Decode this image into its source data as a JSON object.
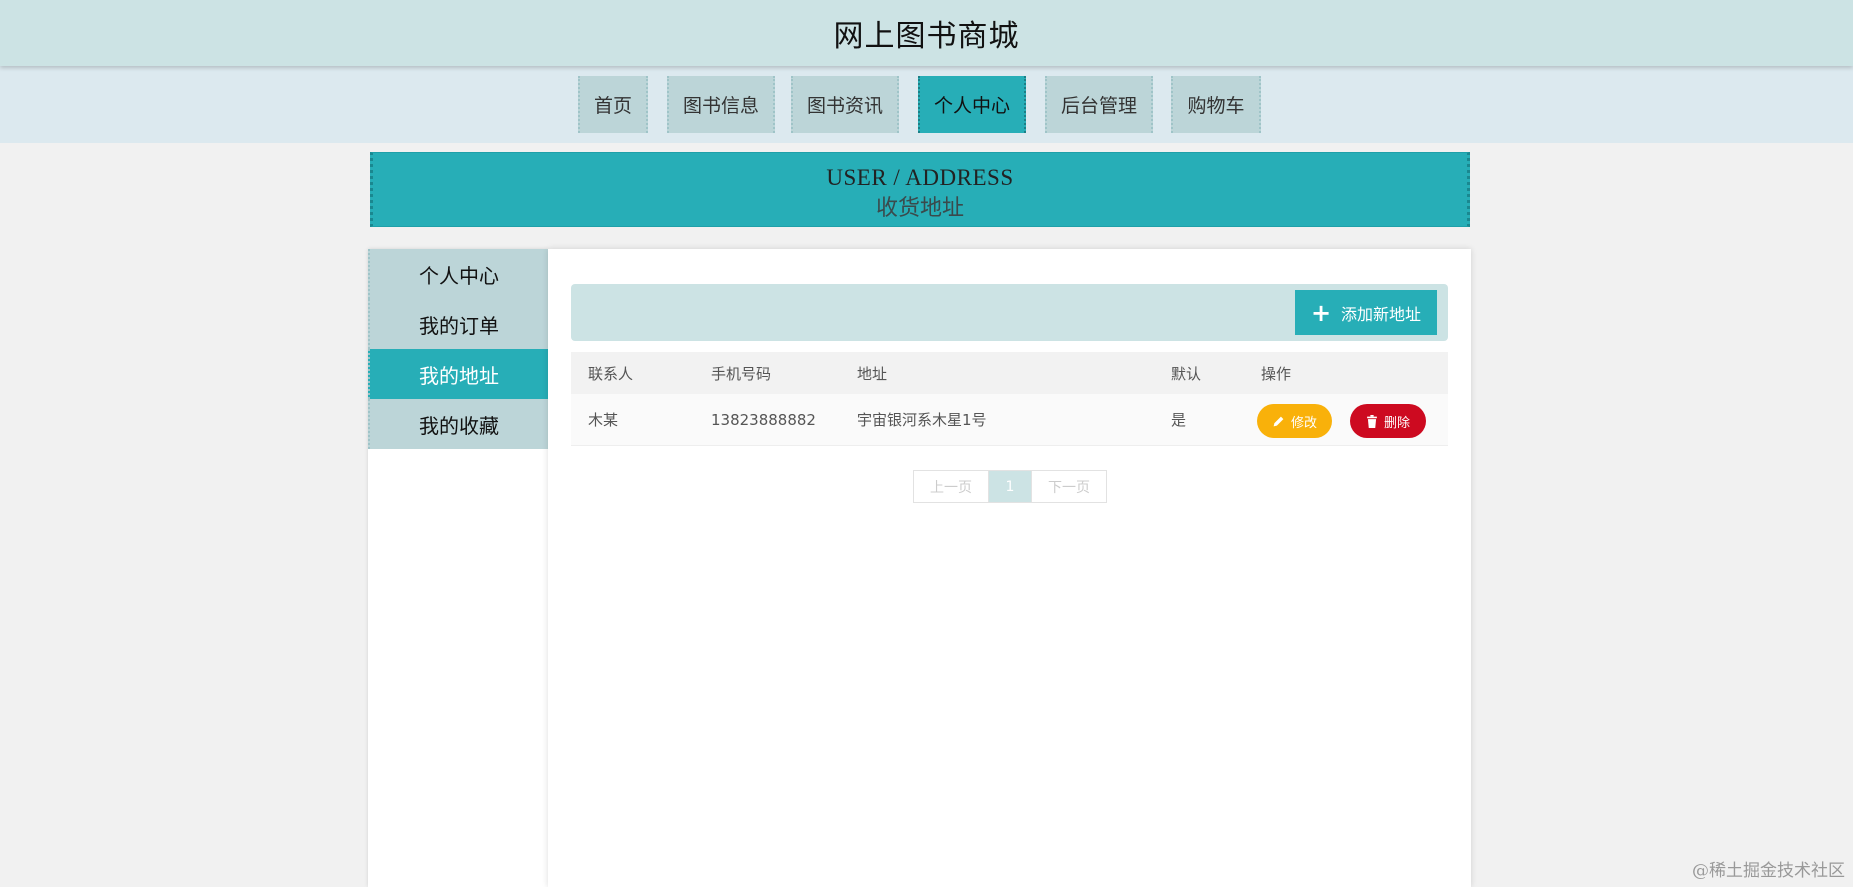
{
  "header": {
    "title": "网上图书商城"
  },
  "nav": {
    "items": [
      {
        "label": "首页"
      },
      {
        "label": "图书信息"
      },
      {
        "label": "图书资讯"
      },
      {
        "label": "个人中心",
        "active": true
      },
      {
        "label": "后台管理"
      },
      {
        "label": "购物车"
      }
    ]
  },
  "banner": {
    "en": "USER / ADDRESS",
    "zh": "收货地址"
  },
  "sidebar": {
    "items": [
      {
        "label": "个人中心"
      },
      {
        "label": "我的订单"
      },
      {
        "label": "我的地址",
        "active": true
      },
      {
        "label": "我的收藏"
      }
    ]
  },
  "toolbar": {
    "add_label": "添加新地址"
  },
  "table": {
    "columns": [
      "联系人",
      "手机号码",
      "地址",
      "默认",
      "操作"
    ],
    "rows": [
      {
        "contact": "木某",
        "phone": "13823888882",
        "address": "宇宙银河系木星1号",
        "default": "是"
      }
    ],
    "edit_label": "修改",
    "delete_label": "删除"
  },
  "pager": {
    "prev": "上一页",
    "current": "1",
    "next": "下一页"
  },
  "watermark": "@稀土掘金技术社区",
  "colors": {
    "accent": "#27aeb7",
    "header_bg": "#cce3e4",
    "nav_bg": "#dce9ef",
    "tab_bg": "#bcd5d8",
    "edit": "#f9b10a",
    "delete": "#cd0a20"
  }
}
